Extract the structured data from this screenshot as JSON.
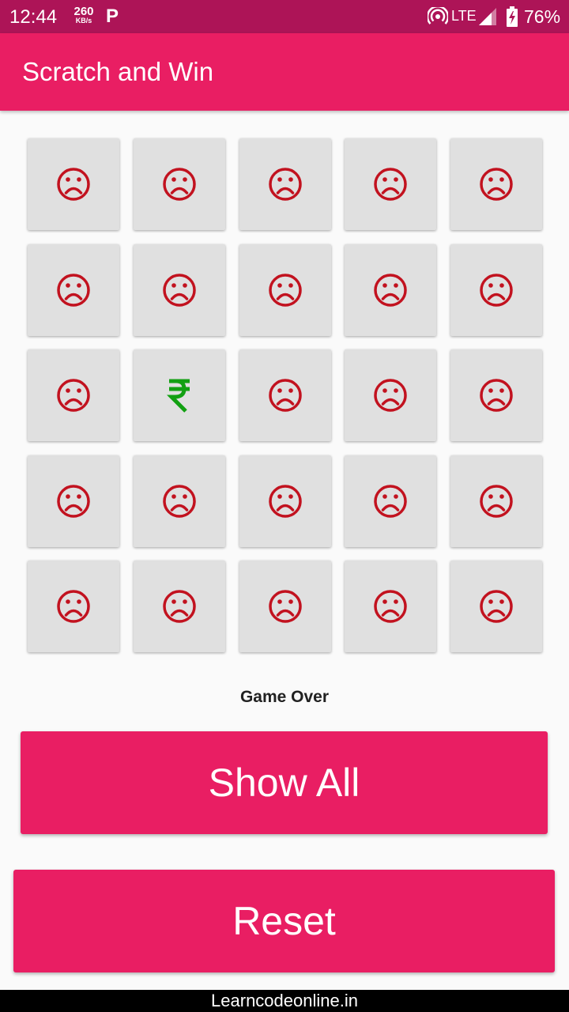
{
  "status_bar": {
    "time": "12:44",
    "net_speed": "260",
    "net_unit": "KB/s",
    "app_icon": "P",
    "network_type": "LTE",
    "battery_percent": "76%"
  },
  "app_bar": {
    "title": "Scratch and Win"
  },
  "board": {
    "tiles": [
      "sad",
      "sad",
      "sad",
      "sad",
      "sad",
      "sad",
      "sad",
      "sad",
      "sad",
      "sad",
      "sad",
      "rupee",
      "sad",
      "sad",
      "sad",
      "sad",
      "sad",
      "sad",
      "sad",
      "sad",
      "sad",
      "sad",
      "sad",
      "sad",
      "sad"
    ],
    "icon_colors": {
      "sad": "#c2121f",
      "rupee": "#12a012"
    }
  },
  "game_status": "Game Over",
  "buttons": {
    "show_all": "Show All",
    "reset": "Reset"
  },
  "footer": {
    "text": "Learncodeonline.in"
  },
  "colors": {
    "primary": "#e91e63",
    "primary_dark": "#ad1457",
    "tile": "#e0e0e0"
  }
}
